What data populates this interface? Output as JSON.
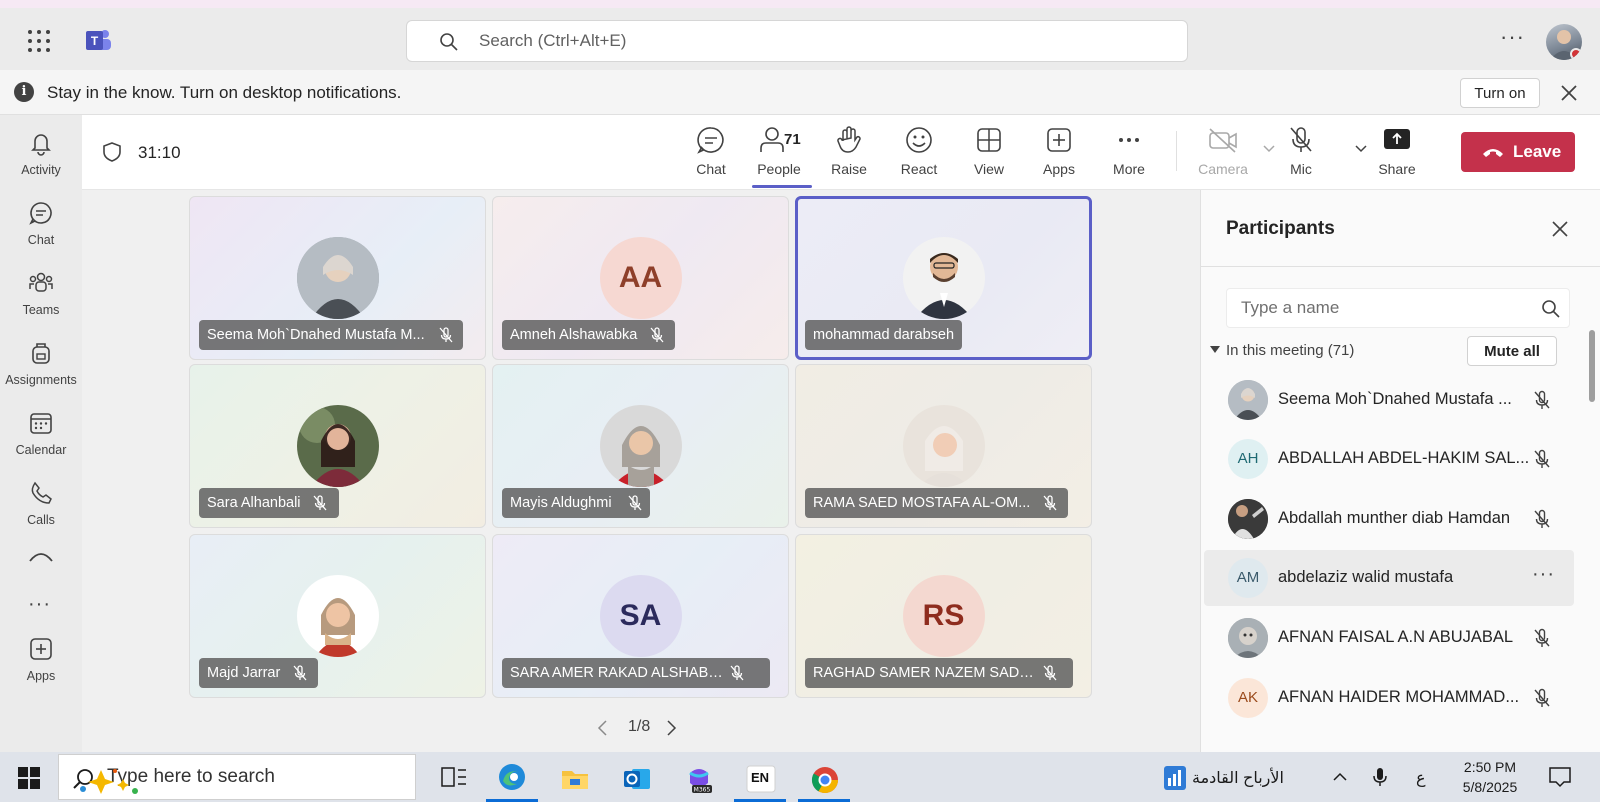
{
  "header": {
    "search_placeholder": "Search (Ctrl+Alt+E)"
  },
  "notification": {
    "message": "Stay in the know. Turn on desktop notifications.",
    "turn_on_label": "Turn on"
  },
  "rail": {
    "items": [
      {
        "label": "Activity",
        "icon": "bell-icon"
      },
      {
        "label": "Chat",
        "icon": "chat-icon"
      },
      {
        "label": "Teams",
        "icon": "teams-icon"
      },
      {
        "label": "Assignments",
        "icon": "backpack-icon"
      },
      {
        "label": "Calendar",
        "icon": "calendar-icon"
      },
      {
        "label": "Calls",
        "icon": "phone-icon"
      },
      {
        "label": "Apps",
        "icon": "plus-box-icon"
      }
    ]
  },
  "meeting": {
    "timer": "31:10",
    "people_count": "71",
    "toolbar": {
      "chat": "Chat",
      "people": "People",
      "raise": "Raise",
      "react": "React",
      "view": "View",
      "apps": "Apps",
      "more": "More",
      "camera": "Camera",
      "mic": "Mic",
      "share": "Share",
      "leave": "Leave"
    }
  },
  "tiles": [
    {
      "name": "Seema Moh`Dnahed Mustafa M...",
      "type": "photo",
      "muted": true,
      "active": false
    },
    {
      "name": "Amneh Alshawabka",
      "type": "initials",
      "initials": "AA",
      "muted": true,
      "active": false
    },
    {
      "name": "mohammad darabseh",
      "type": "photo",
      "muted": false,
      "active": true
    },
    {
      "name": "Sara Alhanbali",
      "type": "photo",
      "muted": true,
      "active": false
    },
    {
      "name": "Mayis Aldughmi",
      "type": "photo",
      "muted": true,
      "active": false
    },
    {
      "name": "RAMA SAED MOSTAFA AL-OM...",
      "type": "photo",
      "muted": true,
      "active": false
    },
    {
      "name": "Majd Jarrar",
      "type": "photo",
      "muted": true,
      "active": false
    },
    {
      "name": "SARA AMER RAKAD ALSHABEEB",
      "type": "initials",
      "initials": "SA",
      "muted": true,
      "active": false
    },
    {
      "name": "RAGHAD SAMER NAZEM SADA...",
      "type": "initials",
      "initials": "RS",
      "muted": true,
      "active": false
    }
  ],
  "pager": {
    "text": "1/8"
  },
  "participants_panel": {
    "title": "Participants",
    "search_placeholder": "Type a name",
    "section_label": "In this meeting (71)",
    "mute_all_label": "Mute all",
    "participants": [
      {
        "name": "Seema Moh`Dnahed Mustafa ...",
        "avatar": "photo",
        "muted": true
      },
      {
        "name": "ABDALLAH ABDEL-HAKIM SAL...",
        "avatar": "initials",
        "initials": "AH",
        "muted": true
      },
      {
        "name": "Abdallah munther diab Hamdan",
        "avatar": "photo",
        "muted": true
      },
      {
        "name": "abdelaziz walid mustafa",
        "avatar": "initials",
        "initials": "AM",
        "muted": false,
        "hovered": true
      },
      {
        "name": "AFNAN FAISAL A.N ABUJABAL",
        "avatar": "photo",
        "muted": true
      },
      {
        "name": "AFNAN HAIDER MOHAMMAD...",
        "avatar": "initials",
        "initials": "AK",
        "muted": true
      }
    ]
  },
  "taskbar": {
    "search_placeholder": "Type here to search",
    "weather_text": "الأرباح القادمة",
    "lang_indicator": "ع",
    "time": "2:50 PM",
    "date": "5/8/2025",
    "keyboard_lang": "EN"
  },
  "colors": {
    "accent": "#5b5fc7",
    "leave": "#c4314b"
  }
}
